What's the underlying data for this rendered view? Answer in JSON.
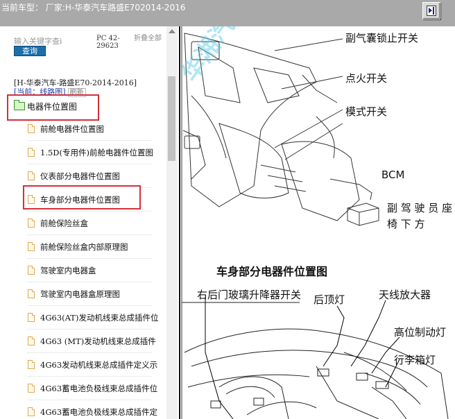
{
  "header": {
    "title": "当前车型： 厂家:H-华泰汽车路盛E702014-2016",
    "toggle_icon": "panel-toggle-icon"
  },
  "sidebar": {
    "search": {
      "placeholder": "输入关键字查i",
      "button_label": "查询"
    },
    "pc_code": "PC 42-29623",
    "collapse_all": "折叠全部",
    "vehicle": "[H-华泰汽车-路盛E70-2014-2016]",
    "current_label": "[当前：线路图]",
    "refresh_label": "刷新",
    "root": {
      "label": "电器件位置图",
      "icon": "folder-open-icon"
    },
    "items": [
      {
        "label": "前舱电器件位置图"
      },
      {
        "label": "1.5D(专用件)前舱电器件位置图"
      },
      {
        "label": "仪表部分电器件位置图"
      },
      {
        "label": "车身部分电器件位置图"
      },
      {
        "label": "前舱保险丝盒"
      },
      {
        "label": "前舱保险丝盒内部原理图"
      },
      {
        "label": "驾驶室内电器盒"
      },
      {
        "label": "驾驶室内电器盒原理图"
      },
      {
        "label": "4G63(AT)发动机线束总成插件位"
      },
      {
        "label": "4G63 (MT)发动机线束总成插件"
      },
      {
        "label": "4G63发动机线束总成插件定义示"
      },
      {
        "label": "4G63蓄电池负极线束总成插件位"
      },
      {
        "label": "4G63蓄电池负极线束总成插件定"
      }
    ],
    "highlight_color": "#d32f3a"
  },
  "diagram": {
    "watermark": "华湘汽车",
    "labels": {
      "airbag_switch": "副气囊锁止开关",
      "ignition": "点火开关",
      "mode_switch": "模式开关",
      "bcm": "BCM",
      "passenger_seat": "副 驾 驶 员 座",
      "under_seat": "椅 下 方",
      "section_title": "车身部分电器件位置图",
      "rr_window": "右后门玻璃升降器开关",
      "rear_lamp": "后顶灯",
      "antenna_amp": "天线放大器",
      "brake_light": "高位制动灯",
      "trunk_light": "行李箱灯"
    }
  }
}
